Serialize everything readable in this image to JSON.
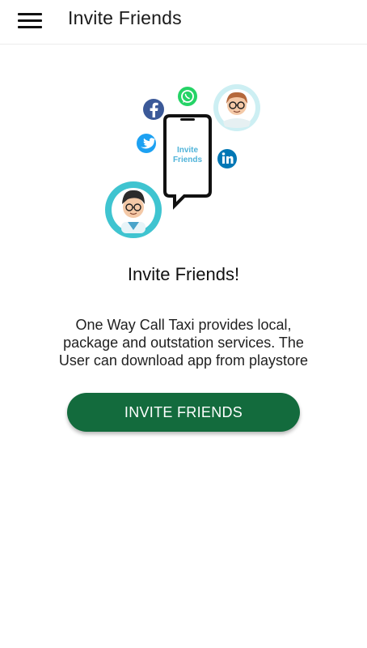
{
  "header": {
    "title": "Invite Friends",
    "menu_icon": "hamburger-menu-icon"
  },
  "illustration": {
    "phone_text_line1": "Invite",
    "phone_text_line2": "Friends",
    "icons": [
      "facebook-icon",
      "whatsapp-icon",
      "twitter-icon",
      "linkedin-icon",
      "person-avatar-icon"
    ]
  },
  "main": {
    "heading": "Invite Friends!",
    "description": "One Way Call Taxi provides local, package and outstation services. The User can download app from playstore",
    "invite_button_label": "INVITE FRIENDS"
  },
  "colors": {
    "button": "#136b3d",
    "facebook": "#3b5998",
    "whatsapp": "#25d366",
    "twitter": "#1da1f2",
    "linkedin": "#0077b5",
    "avatar_ring": "#3fc4d0"
  }
}
